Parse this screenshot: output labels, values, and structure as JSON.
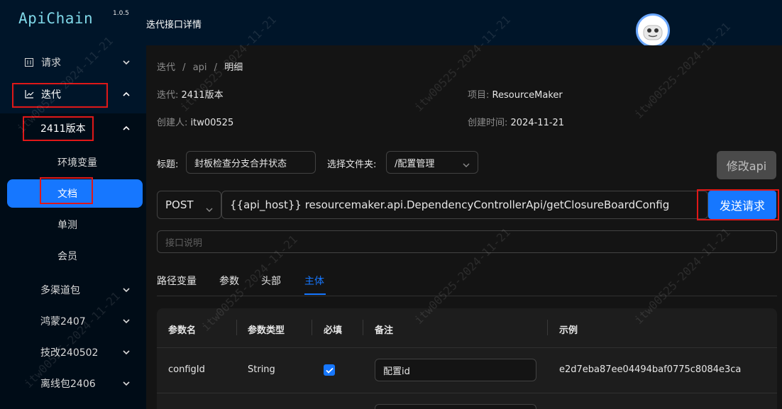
{
  "app": {
    "name": "ApiChain",
    "version": "1.0.5"
  },
  "sidebar": {
    "items": [
      {
        "label": "请求",
        "icon": "request-icon"
      },
      {
        "label": "迭代",
        "icon": "chart-line-icon"
      },
      {
        "label": "2411版本"
      },
      {
        "label": "环境变量"
      },
      {
        "label": "文档"
      },
      {
        "label": "单测"
      },
      {
        "label": "会员"
      },
      {
        "label": "多渠道包"
      },
      {
        "label": "鸿蒙2407"
      },
      {
        "label": "技改240502"
      },
      {
        "label": "离线包2406"
      }
    ]
  },
  "header": {
    "title": "迭代接口详情"
  },
  "breadcrumb": {
    "items": [
      "迭代",
      "api",
      "明细"
    ],
    "sep": "/"
  },
  "meta": {
    "iteration_label": "迭代:",
    "iteration_value": "2411版本",
    "project_label": "项目:",
    "project_value": "ResourceMaker",
    "creator_label": "创建人:",
    "creator_value": "itw00525",
    "created_label": "创建时间:",
    "created_value": "2024-11-21"
  },
  "form": {
    "title_label": "标题:",
    "title_value": "封板检查分支合并状态",
    "folder_label": "选择文件夹:",
    "folder_value": "/配置管理",
    "edit_button": "修改api",
    "method": "POST",
    "url": "{{api_host}} resourcemaker.api.DependencyControllerApi/getClosureBoardConfig",
    "send_button": "发送请求",
    "desc_placeholder": "接口说明"
  },
  "tabs": [
    "路径变量",
    "参数",
    "头部",
    "主体"
  ],
  "table": {
    "headers": [
      "参数名",
      "参数类型",
      "必填",
      "备注",
      "示例"
    ],
    "rows": [
      {
        "name": "configId",
        "type": "String",
        "required": true,
        "remark": "配置id",
        "example": "e2d7eba87ee04494baf0775c8084e3ca"
      }
    ]
  },
  "watermark": {
    "text": "itw00525-2024-11-21"
  },
  "colors": {
    "accent": "#1677ff",
    "sidebar": "#001529",
    "highlight": "#e01818"
  }
}
